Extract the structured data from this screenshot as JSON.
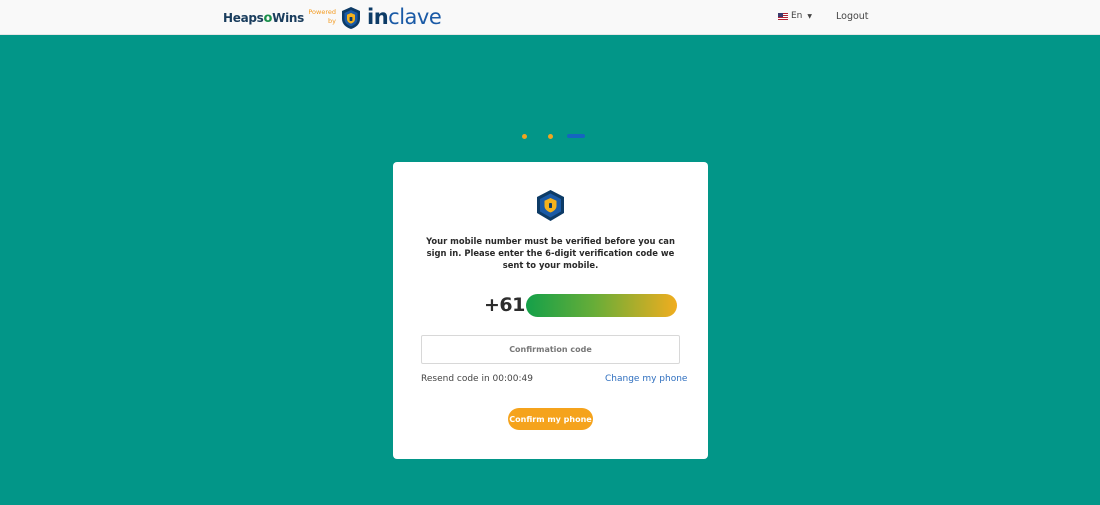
{
  "header": {
    "brand_heaps": "Heaps",
    "brand_o": "o",
    "brand_wins": "Wins",
    "powered_line1": "Powered",
    "powered_line2": "by",
    "inclave_in": "in",
    "inclave_clave": "clave",
    "language_label": "En",
    "logout_label": "Logout"
  },
  "steps": {
    "total": 3,
    "current": 3
  },
  "card": {
    "message": "Your mobile number must be verified before you can sign in. Please enter the 6-digit verification code we sent to your mobile.",
    "phone_prefix": "+61",
    "code_placeholder": "Confirmation code",
    "code_value": "",
    "resend_text": "Resend code in 00:00:49",
    "change_phone_label": "Change my phone",
    "confirm_label": "Confirm my phone"
  },
  "colors": {
    "background": "#029688",
    "accent_orange": "#f5a31c",
    "step_blue": "#1565c0",
    "link_blue": "#2f6fbf"
  },
  "icons": {
    "header_logo": "shield-logo-icon",
    "card_logo": "shield-lock-icon",
    "language": "us-flag-icon"
  }
}
